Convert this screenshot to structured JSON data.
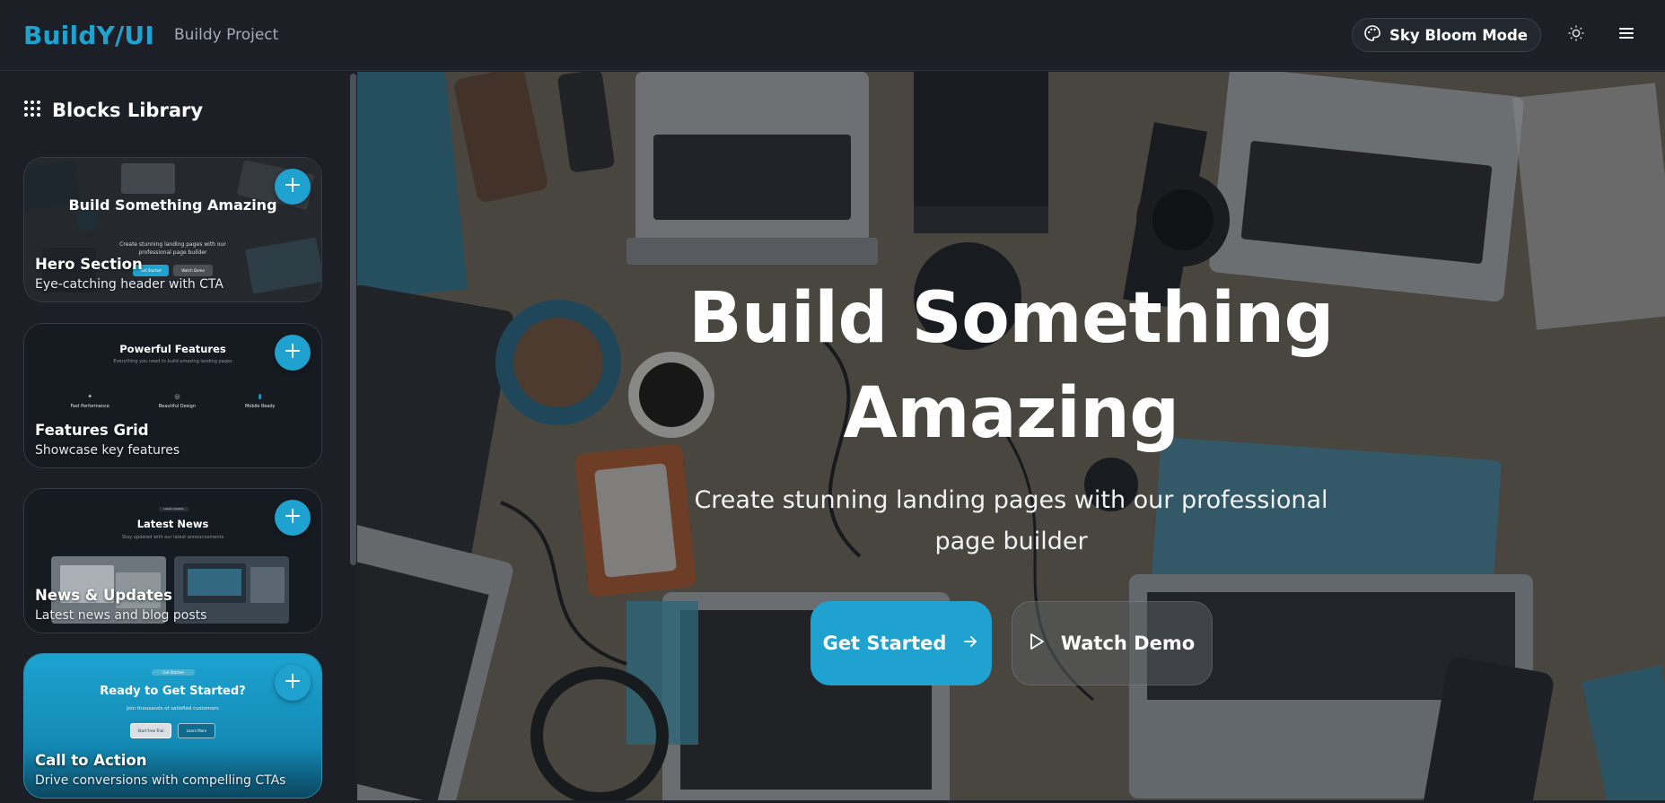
{
  "header": {
    "brand": "BuildY/UI",
    "project_name": "Buildy Project",
    "mode_label": "Sky Bloom Mode"
  },
  "sidebar": {
    "title": "Blocks Library",
    "blocks": [
      {
        "title": "Hero Section",
        "description": "Eye-catching header with CTA",
        "preview_heading": "Build Something Amazing",
        "preview_sub": "Create stunning landing pages with our professional page builder",
        "preview_btn_primary": "Get Started",
        "preview_btn_secondary": "Watch Demo"
      },
      {
        "title": "Features Grid",
        "description": "Showcase key features",
        "preview_heading": "Powerful Features",
        "preview_sub": "Everything you need to build amazing landing pages",
        "preview_items": [
          "Fast Performance",
          "Beautiful Design",
          "Mobile Ready"
        ]
      },
      {
        "title": "News & Updates",
        "description": "Latest news and blog posts",
        "preview_badge": "Latest Updates",
        "preview_heading": "Latest News",
        "preview_sub": "Stay updated with our latest announcements"
      },
      {
        "title": "Call to Action",
        "description": "Drive conversions with compelling CTAs",
        "preview_badge": "Get Started",
        "preview_heading": "Ready to Get Started?",
        "preview_sub": "Join thousands of satisfied customers",
        "preview_btn_primary": "Start Free Trial",
        "preview_btn_secondary": "Learn More"
      }
    ]
  },
  "hero": {
    "title_line1": "Build Something",
    "title_line2": "Amazing",
    "subtitle_line1": "Create stunning landing pages with our professional",
    "subtitle_line2": "page builder",
    "primary_button": "Get Started",
    "secondary_button": "Watch Demo"
  },
  "colors": {
    "accent": "#1fa2cf",
    "topbar": "#1c2026",
    "sidebar": "#1c2026"
  },
  "icons": {
    "mode": "palette-icon",
    "theme": "sun-icon",
    "menu": "hamburger-menu-icon",
    "library": "grid-dots-icon",
    "add": "plus-icon",
    "arrow": "arrow-right-icon",
    "play": "play-icon"
  }
}
